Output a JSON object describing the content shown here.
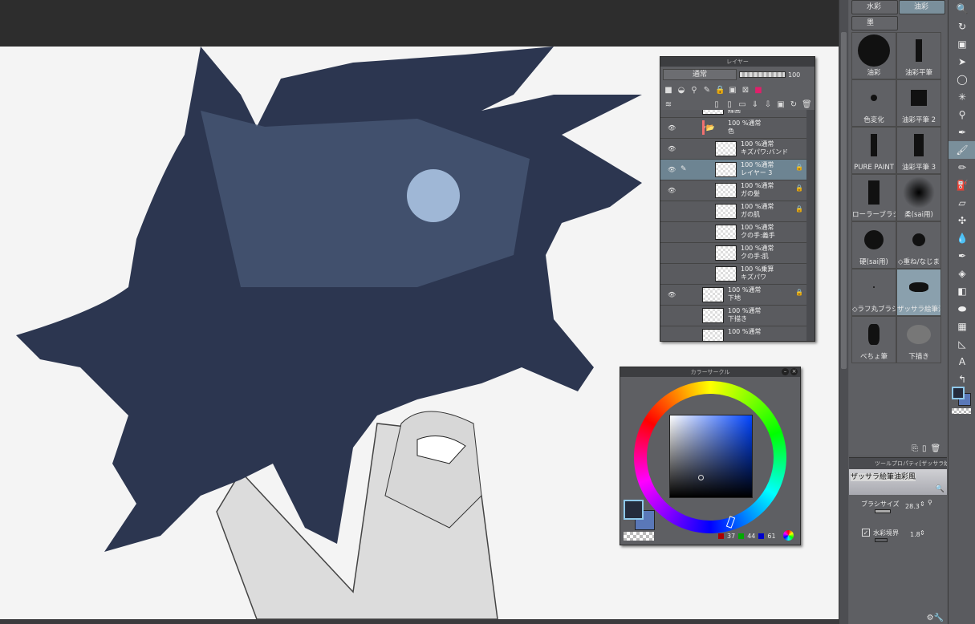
{
  "layer_panel": {
    "title": "レイヤー",
    "blend_mode": "通常",
    "opacity": "100",
    "layers": [
      {
        "top_text": "",
        "name": "線画"
      },
      {
        "top_text": "100 %通常",
        "name": "色",
        "folder": true
      },
      {
        "top_text": "100 %通常",
        "name": "キズパワ:バンド"
      },
      {
        "top_text": "100 %通常",
        "name": "レイヤー 3",
        "selected": true,
        "locked": true
      },
      {
        "top_text": "100 %通常",
        "name": "ガの髪",
        "locked": true
      },
      {
        "top_text": "100 %通常",
        "name": "ガの肌",
        "locked": true
      },
      {
        "top_text": "100 %通常",
        "name": "クの手:義手"
      },
      {
        "top_text": "100 %通常",
        "name": "クの手:肌"
      },
      {
        "top_text": "100 %乗算",
        "name": "キズパワ"
      },
      {
        "top_text": "100 %通常",
        "name": "下地",
        "locked": true
      },
      {
        "top_text": "100 %通常",
        "name": "下描き"
      },
      {
        "top_text": "100 %通常",
        "name": ""
      }
    ]
  },
  "color_circle": {
    "title": "カラーサークル",
    "r": "37",
    "g": "44",
    "b": "61",
    "main_color": "#252c3d",
    "sub_color": "#5a78b8"
  },
  "brush_tabs": [
    "水彩",
    "油彩",
    "墨"
  ],
  "brushes": [
    "油彩",
    "油彩平筆",
    "色変化",
    "油彩平筆 2",
    "PURE PAINT",
    "油彩平筆 3",
    "ローラーブラシ",
    "柔(sai用)",
    "硬(sai用)",
    "◇重ね/なじま",
    "◇ラフ丸ブラシ",
    "ザッサラ絵筆油",
    "べちょ筆",
    "下描き"
  ],
  "tool_property": {
    "title": "ツールプロパティ[ザッサラ絵",
    "preset": "ザッサラ絵筆油彩風",
    "brush_size_label": "ブラシサイズ",
    "brush_size": "28.3",
    "watercolor_edge_label": "水彩境界",
    "watercolor_edge": "1.8",
    "watercolor_edge_checked": true
  },
  "accent": "#7a8f9b"
}
